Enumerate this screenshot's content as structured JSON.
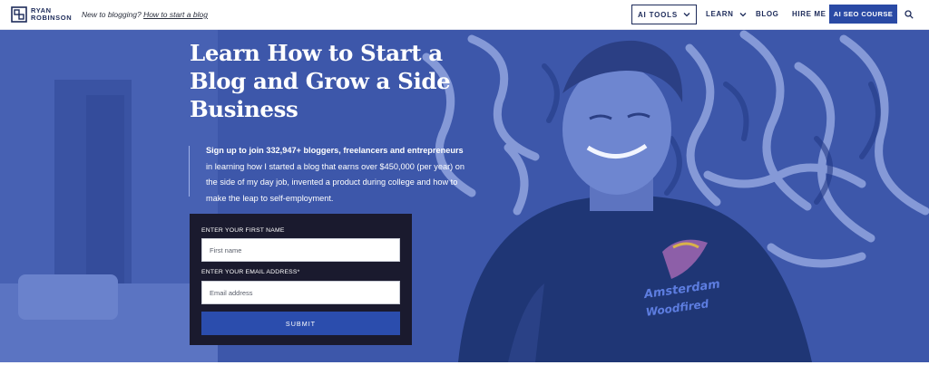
{
  "header": {
    "logo_line1": "RYAN",
    "logo_line2": "ROBINSON",
    "tagline_prefix": "New to blogging?",
    "tagline_link": "How to start a blog"
  },
  "nav": {
    "ai_tools": "AI TOOLS",
    "learn": "LEARN",
    "blog": "BLOG",
    "hire_me": "HIRE ME",
    "cta": "AI SEO COURSE"
  },
  "hero": {
    "title": "Learn How to Start a Blog and Grow a Side Business",
    "intro_bold": "Sign up to join 332,947+ bloggers, freelancers and entrepreneurs",
    "intro_rest": " in learning how I started a blog that earns over $450,000 (per year) on the side of my day job, invented a product during college and how to make the leap to self-employment.",
    "shirt_text_1": "Amsterdam",
    "shirt_text_2": "Woodfired"
  },
  "form": {
    "first_name_label": "ENTER YOUR FIRST NAME",
    "first_name_placeholder": "First name",
    "first_name_value": "",
    "email_label": "ENTER YOUR EMAIL ADDRESS*",
    "email_placeholder": "Email address",
    "email_value": "",
    "submit_label": "SUBMIT"
  },
  "colors": {
    "brand_navy": "#1d2b5a",
    "cta_blue": "#2a4aa5",
    "hero_overlay": "#3b55a8",
    "form_bg": "#1a1a2e"
  }
}
